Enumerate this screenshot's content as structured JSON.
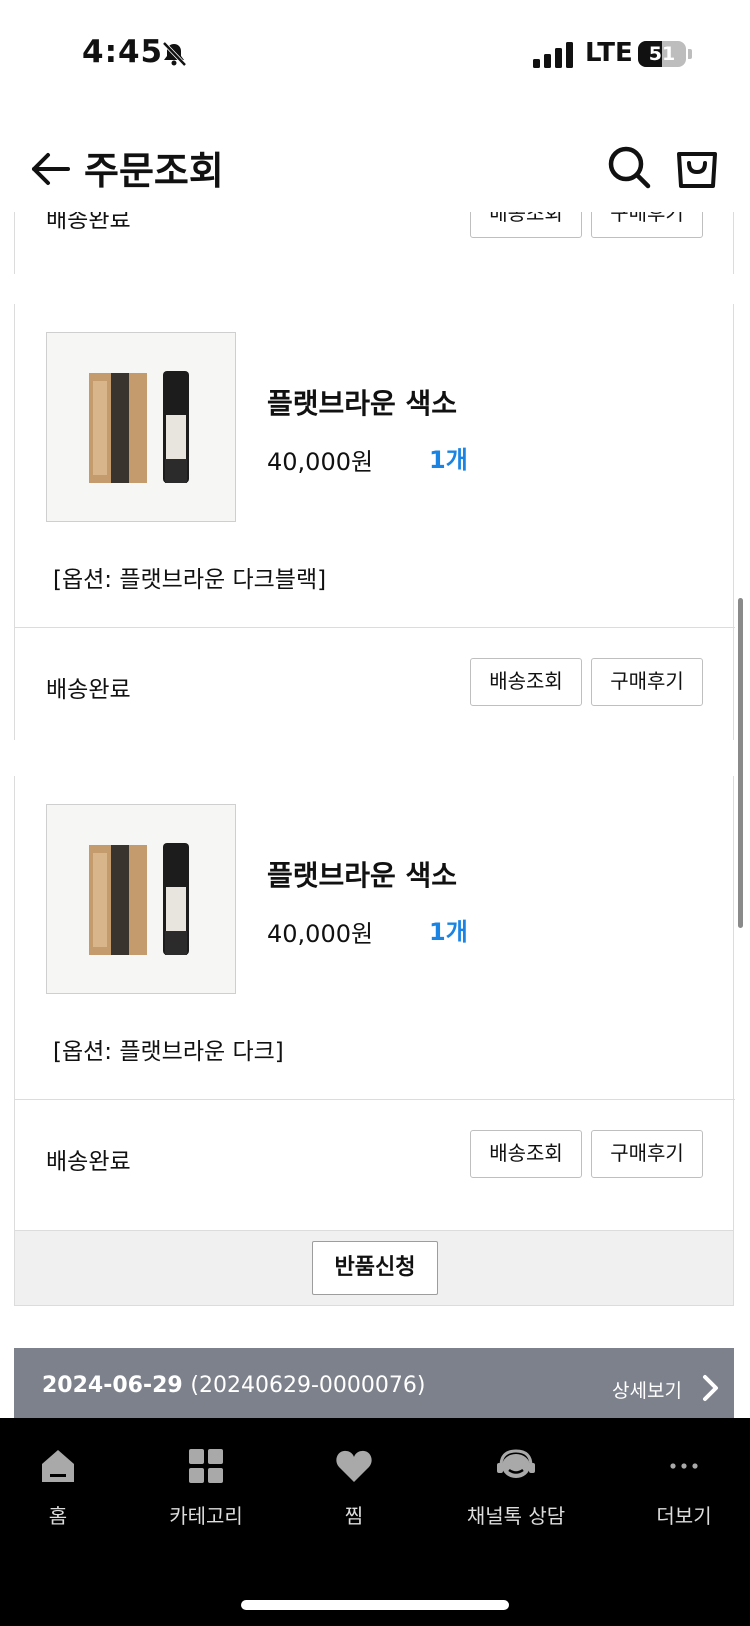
{
  "status_bar": {
    "time": "4:45",
    "network": "LTE",
    "battery": "51",
    "battery_fraction": 0.51,
    "icons": [
      "bell-muted-icon",
      "signal-icon",
      "battery-icon"
    ]
  },
  "header": {
    "title": "주문조회",
    "icons": [
      "back-arrow-icon",
      "search-icon",
      "shopping-bag-icon"
    ]
  },
  "partial_card": {
    "status": "배송완료",
    "track_label": "배송조회",
    "review_label": "구매후기"
  },
  "items": [
    {
      "name": "플랫브라운 색소",
      "price": "40,000원",
      "qty": "1개",
      "option": "[옵션: 플랫브라운 다크블랙]",
      "status": "배송완료",
      "track_label": "배송조회",
      "review_label": "구매후기"
    },
    {
      "name": "플랫브라운 색소",
      "price": "40,000원",
      "qty": "1개",
      "option": "[옵션: 플랫브라운 다크]",
      "status": "배송완료",
      "track_label": "배송조회",
      "review_label": "구매후기"
    }
  ],
  "return_button": "반품신청",
  "next_order": {
    "date": "2024-06-29",
    "number": "(20240629-0000076)",
    "detail_label": "상세보기"
  },
  "colors": {
    "accent_qty": "#1a84e5",
    "order_header_bg": "#7d818b",
    "nav_bg": "#000000"
  },
  "bottom_nav": [
    {
      "label": "홈",
      "icon": "home-icon"
    },
    {
      "label": "카테고리",
      "icon": "grid-icon"
    },
    {
      "label": "찜",
      "icon": "heart-icon"
    },
    {
      "label": "채널톡 상담",
      "icon": "headset-icon"
    },
    {
      "label": "더보기",
      "icon": "more-dots-icon"
    }
  ]
}
